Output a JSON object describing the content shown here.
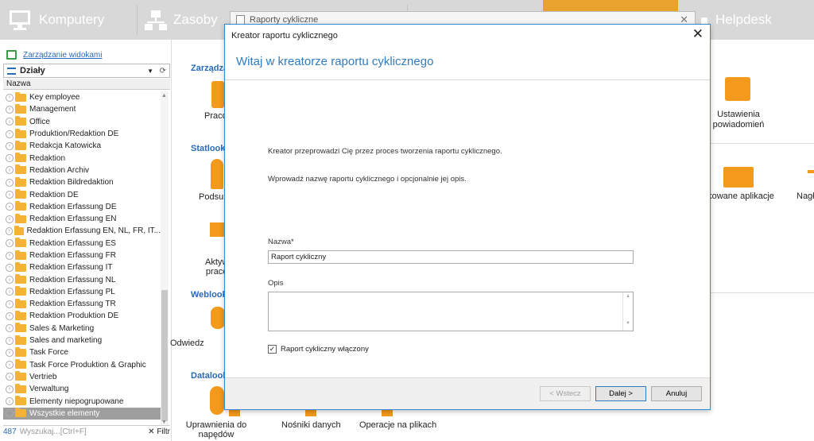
{
  "topbar": {
    "tabs": [
      {
        "label": "Komputery",
        "icon": "monitor-icon"
      },
      {
        "label": "Zasoby",
        "icon": "network-icon"
      },
      {
        "label": "Helpdesk",
        "icon": "phone-icon"
      }
    ],
    "accent": "#e9a22d"
  },
  "left": {
    "manage_link": "Zarządzanie widokami",
    "dropdown_label": "Działy",
    "column_header": "Nazwa",
    "items": [
      "Key employee",
      "Management",
      "Office",
      "Produktion/Redaktion DE",
      "Redakcja Katowicka",
      "Redaktion",
      "Redaktion Archiv",
      "Redaktion Bildredaktion",
      "Redaktion DE",
      "Redaktion Erfassung DE",
      "Redaktion Erfassung EN",
      "Redaktion Erfassung EN, NL, FR, IT...",
      "Redaktion Erfassung ES",
      "Redaktion Erfassung FR",
      "Redaktion Erfassung IT",
      "Redaktion Erfassung NL",
      "Redaktion Erfassung PL",
      "Redaktion Erfassung TR",
      "Redaktion Produktion DE",
      "Sales & Marketing",
      "Sales and marketing",
      "Task Force",
      "Task Force Produktion & Graphic",
      "Vertrieb",
      "Verwaltung",
      "Elementy niepogrupowane",
      "Wszystkie elementy"
    ],
    "search": {
      "count": "487",
      "placeholder": "Wyszukaj...[Ctrl+F]",
      "filter_label": "Filtr"
    }
  },
  "main": {
    "sections": [
      "Zarządzan",
      "Statlook",
      "Weblook",
      "Datalook"
    ],
    "tiles": {
      "pracownicy": "Praco",
      "podsumowanie": "Podsum",
      "aktywnosc1": "Aktyw",
      "aktywnosc2": "praco",
      "odwiedzone": "Odwiedz",
      "ustawienia1": "Ustawienia",
      "ustawienia2": "powiadomień",
      "blokowane": "okowane aplikacje",
      "naglowek": "Nagł",
      "uprawnienia1": "Uprawnienia do",
      "uprawnienia2": "napędów",
      "nosniki": "Nośniki danych",
      "operacje": "Operacje na plikach"
    }
  },
  "behind_window": {
    "title": "Raporty cykliczne"
  },
  "dialog": {
    "title": "Kreator raportu cyklicznego",
    "heading": "Witaj w kreatorze raportu cyklicznego",
    "intro": "Kreator przeprowadzi Cię przez proces tworzenia raportu cyklicznego.",
    "instruction": "Wprowadź nazwę raportu cyklicznego i opcjonalnie jej opis.",
    "name_label": "Nazwa*",
    "name_value": "Raport cykliczny",
    "desc_label": "Opis",
    "desc_value": "",
    "checkbox_label": "Raport cykliczny włączony",
    "checkbox_checked": true,
    "buttons": {
      "back": "< Wstecz",
      "next": "Dalej >",
      "cancel": "Anuluj"
    }
  }
}
